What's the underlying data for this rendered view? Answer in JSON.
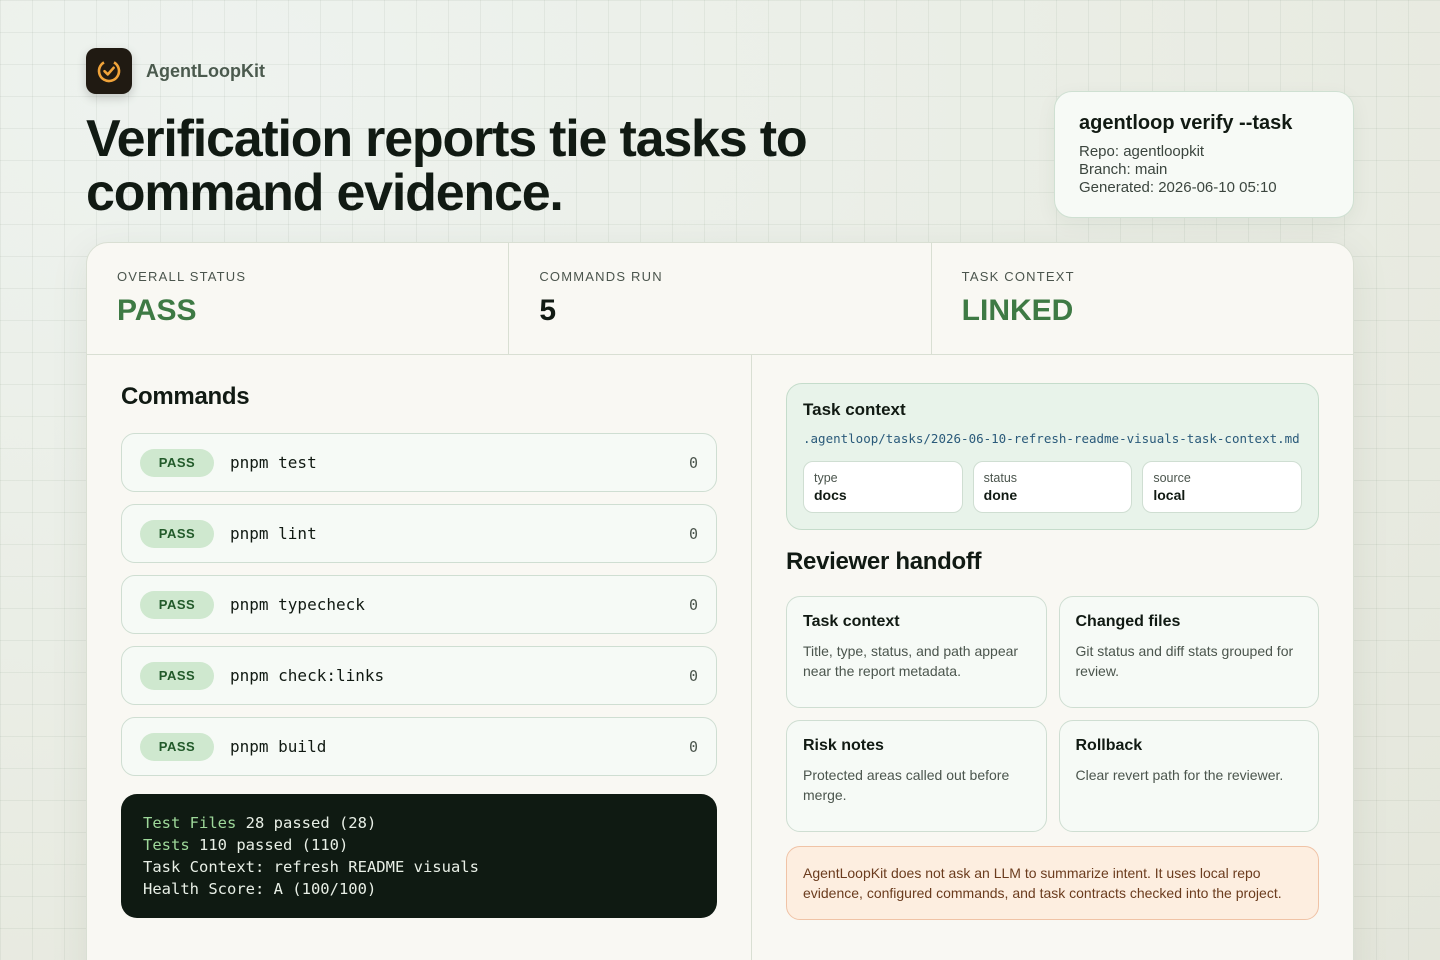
{
  "brand": {
    "name": "AgentLoopKit",
    "logo_icon": "check-circle-icon",
    "logo_accent": "#f0a33a"
  },
  "hero": {
    "title": "Verification reports tie tasks to command evidence."
  },
  "command_card": {
    "title": "agentloop verify --task",
    "repo": "Repo: agentloopkit",
    "branch": "Branch: main",
    "generated": "Generated: 2026-06-10 05:10"
  },
  "stats": [
    {
      "label": "OVERALL STATUS",
      "value": "PASS"
    },
    {
      "label": "COMMANDS RUN",
      "value": "5"
    },
    {
      "label": "TASK CONTEXT",
      "value": "LINKED"
    }
  ],
  "commands": {
    "title": "Commands",
    "items": [
      {
        "status": "PASS",
        "command": "pnpm test",
        "exit_code": "0"
      },
      {
        "status": "PASS",
        "command": "pnpm lint",
        "exit_code": "0"
      },
      {
        "status": "PASS",
        "command": "pnpm typecheck",
        "exit_code": "0"
      },
      {
        "status": "PASS",
        "command": "pnpm check:links",
        "exit_code": "0"
      },
      {
        "status": "PASS",
        "command": "pnpm build",
        "exit_code": "0"
      }
    ]
  },
  "terminal": {
    "line1_label": "Test Files",
    "line1_value": " 28 passed (28)",
    "line2_label": "Tests",
    "line2_value": " 110 passed (110)",
    "line3": "Task Context: refresh README visuals",
    "line4": "Health Score: A (100/100)"
  },
  "task_context": {
    "title": "Task context",
    "path": ".agentloop/tasks/2026-06-10-refresh-readme-visuals-task-context.md",
    "meta": [
      {
        "key": "type",
        "value": "docs"
      },
      {
        "key": "status",
        "value": "done"
      },
      {
        "key": "source",
        "value": "local"
      }
    ]
  },
  "handoff": {
    "title": "Reviewer handoff",
    "cards": [
      {
        "title": "Task context",
        "desc": "Title, type, status, and path appear near the report metadata."
      },
      {
        "title": "Changed files",
        "desc": "Git status and diff stats grouped for review."
      },
      {
        "title": "Risk notes",
        "desc": "Protected areas called out before merge."
      },
      {
        "title": "Rollback",
        "desc": "Clear revert path for the reviewer."
      }
    ]
  },
  "note": "AgentLoopKit does not ask an LLM to summarize intent. It uses local repo evidence, configured commands, and task contracts checked into the project.",
  "colors": {
    "pass_green": "#3e7a44",
    "badge_bg": "#cfe8cf",
    "terminal_bg": "#0f1a12",
    "note_bg": "#fdeee0"
  }
}
